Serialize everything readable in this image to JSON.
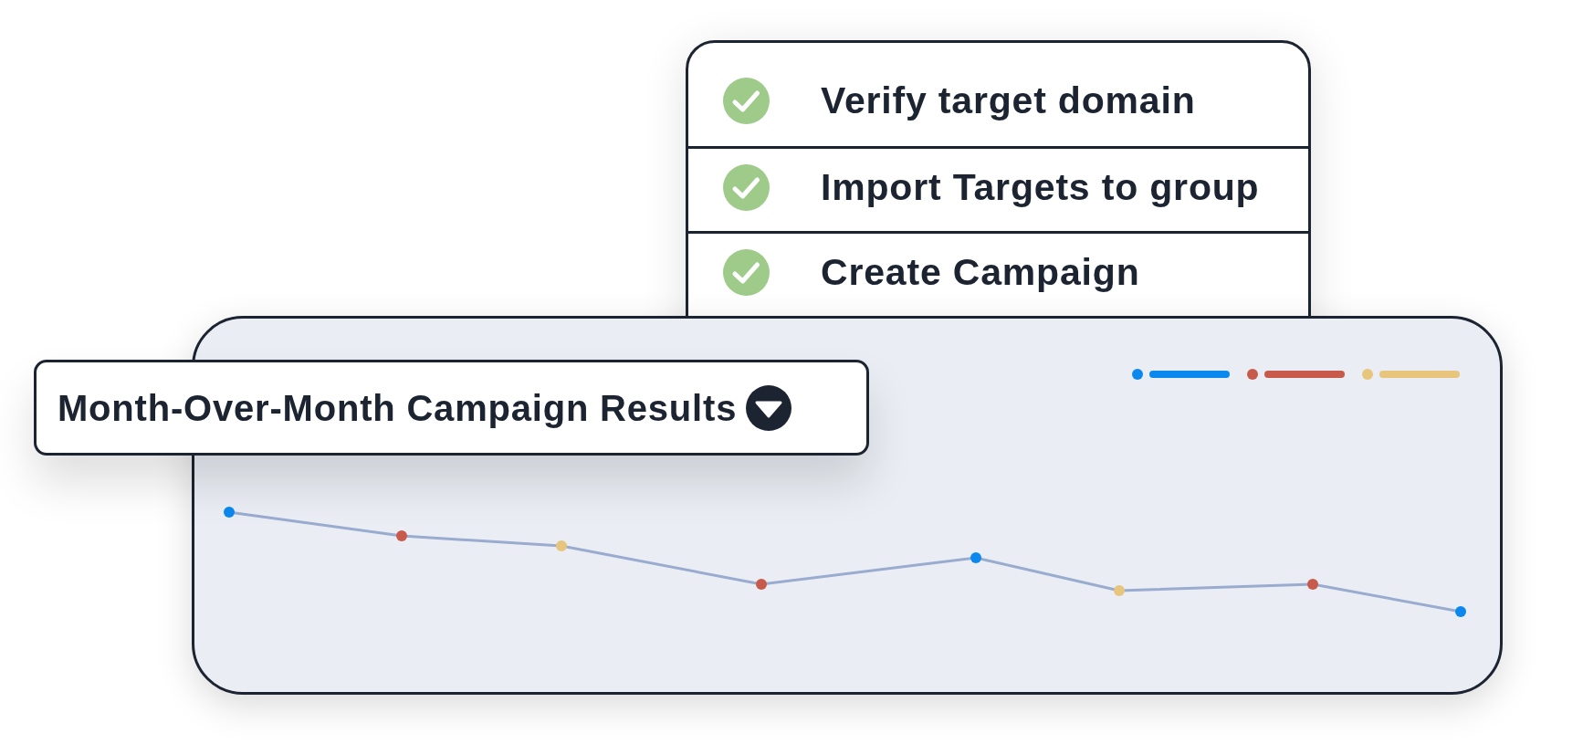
{
  "checklist": {
    "items": [
      {
        "label": "Verify target domain",
        "checked": true
      },
      {
        "label": "Import Targets to group",
        "checked": true
      },
      {
        "label": "Create Campaign",
        "checked": true
      }
    ]
  },
  "chart_card": {
    "title": "Month-Over-Month Campaign Results",
    "legend": [
      {
        "color": "#0b88ee"
      },
      {
        "color": "#c85a4b"
      },
      {
        "color": "#e7c57d"
      }
    ],
    "points": [
      {
        "color": "#0b88ee"
      },
      {
        "color": "#c85a4b"
      },
      {
        "color": "#e7c57d"
      },
      {
        "color": "#c85a4b"
      },
      {
        "color": "#0b88ee"
      },
      {
        "color": "#e7c57d"
      },
      {
        "color": "#c85a4b"
      },
      {
        "color": "#0b88ee"
      }
    ]
  }
}
